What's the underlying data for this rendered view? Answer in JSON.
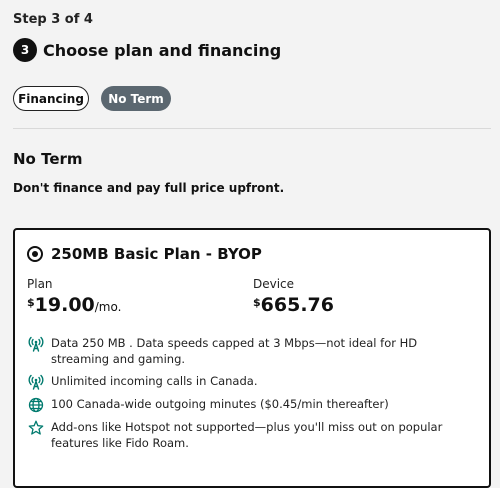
{
  "step": {
    "text": "Step 3 of 4",
    "number": "3",
    "title": "Choose plan and financing"
  },
  "toggles": {
    "financing": "Financing",
    "no_term": "No Term",
    "selected": "no_term"
  },
  "section": {
    "title": "No Term",
    "description": "Don't finance and pay full price upfront."
  },
  "plan_card": {
    "name": "250MB Basic Plan - BYOP",
    "selected": true,
    "plan_label": "Plan",
    "plan_currency": "$",
    "plan_amount": "19.00",
    "plan_unit": "/mo.",
    "device_label": "Device",
    "device_currency": "$",
    "device_amount": "665.76",
    "features": [
      {
        "icon": "signal-tower-icon",
        "text": "Data 250 MB . Data speeds capped at 3 Mbps—not ideal for HD streaming and gaming."
      },
      {
        "icon": "signal-tower-icon",
        "text": "Unlimited incoming calls in Canada."
      },
      {
        "icon": "globe-icon",
        "text": "100 Canada-wide outgoing minutes ($0.45/min thereafter)"
      },
      {
        "icon": "star-icon",
        "text": "Add-ons like Hotspot not supported—plus you'll miss out on popular features like Fido Roam."
      }
    ]
  },
  "colors": {
    "accent": "#007a6e",
    "toggle_selected": "#5b6770",
    "background": "#f3f3f3"
  }
}
